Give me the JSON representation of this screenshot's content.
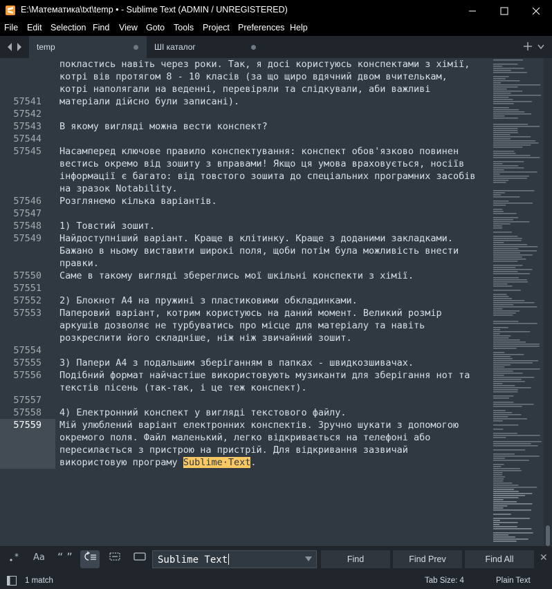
{
  "window": {
    "title": "E:\\Математика\\txt\\temp • - Sublime Text (ADMIN / UNREGISTERED)"
  },
  "menu": [
    "File",
    "Edit",
    "Selection",
    "Find",
    "View",
    "Goto",
    "Tools",
    "Project",
    "Preferences",
    "Help"
  ],
  "tabs": [
    {
      "label": "temp",
      "active": true
    },
    {
      "label": "ШІ каталог",
      "active": false
    }
  ],
  "editor": {
    "lines": [
      {
        "num": "",
        "text": "покластись навіть через роки. Так, я досі користуюсь конспектами з хімії,"
      },
      {
        "num": "",
        "text": "котрі вів протягом 8 - 10 класів (за що щиро вдячний двом вчителькам,"
      },
      {
        "num": "",
        "text": "котрі наполягали на веденні, перевіряли та слідкували, аби важливі"
      },
      {
        "num": "57541",
        "text": "матеріали дійсно були записані)."
      },
      {
        "num": "57542",
        "text": ""
      },
      {
        "num": "57543",
        "text": "В якому вигляді можна вести конспект?"
      },
      {
        "num": "57544",
        "text": ""
      },
      {
        "num": "57545",
        "text": "Насамперед ключове правило конспектування: конспект обов'язково повинен"
      },
      {
        "num": "",
        "text": "вестись окремо від зошиту з вправами! Якщо ця умова враховується, носіїв"
      },
      {
        "num": "",
        "text": "інформації є багато: від товстого зошита до спеціальних програмних засобів"
      },
      {
        "num": "",
        "text": "на зразок Notability."
      },
      {
        "num": "57546",
        "text": "Розглянемо кілька варіантів."
      },
      {
        "num": "57547",
        "text": ""
      },
      {
        "num": "57548",
        "text": "1) Товстий зошит."
      },
      {
        "num": "57549",
        "text": "Найдоступніший варіант. Краще в клітинку. Краще з доданими закладками."
      },
      {
        "num": "",
        "text": "Бажано в ньому виставити широкі поля, щоби потім була можливість внести"
      },
      {
        "num": "",
        "text": "правки."
      },
      {
        "num": "57550",
        "text": "Саме в такому вигляді збереглись мої шкільні конспекти з хімії."
      },
      {
        "num": "57551",
        "text": ""
      },
      {
        "num": "57552",
        "text": "2) Блокнот А4 на пружині з пластиковими обкладинками."
      },
      {
        "num": "57553",
        "text": "Паперовий варіант, котрим користуюсь на даний момент. Великий розмір"
      },
      {
        "num": "",
        "text": "аркушів дозволяє не турбуватись про місце для матеріалу та навіть"
      },
      {
        "num": "",
        "text": "розкреслити його складніше, ніж ніж звичайний зошит."
      },
      {
        "num": "57554",
        "text": ""
      },
      {
        "num": "57555",
        "text": "3) Папери А4 з подальшим зберіганням в папках - швидкозшивачах."
      },
      {
        "num": "57556",
        "text": "Подібний формат найчастіше використовують музиканти для зберігання нот та"
      },
      {
        "num": "",
        "text": "текстів пісень (так-так, і це теж конспект)."
      },
      {
        "num": "57557",
        "text": ""
      },
      {
        "num": "57558",
        "text": "4) Електронний конспект у вигляді текстового файлу."
      },
      {
        "num": "57559",
        "text": "Мій улюблений варіант електронних конспектів. Зручно шукати з допомогою"
      },
      {
        "num": "",
        "text": "окремого поля. Файл маленький, легко відкривається на телефоні або"
      },
      {
        "num": "",
        "text": "пересилається з пристрою на пристрій. Для відкривання зазвичай"
      },
      {
        "num": "",
        "text": "використовую програму "
      }
    ],
    "last_line_highlight": "Sublime·Text",
    "last_line_tail": ".",
    "current_line_number": "57559"
  },
  "find": {
    "options": [
      "regex",
      "case",
      "whole-word",
      "wrap",
      "in-selection",
      "highlight"
    ],
    "query": "Sublime Text",
    "buttons": {
      "find": "Find",
      "find_prev": "Find Prev",
      "find_all": "Find All"
    },
    "close": "✕"
  },
  "status": {
    "matches": "1 match",
    "tab_size": "Tab Size: 4",
    "syntax": "Plain Text"
  },
  "colors": {
    "background": "#303841",
    "text": "#d8dee9",
    "highlight": "#fac863",
    "gutter_text": "#a5aab1"
  }
}
